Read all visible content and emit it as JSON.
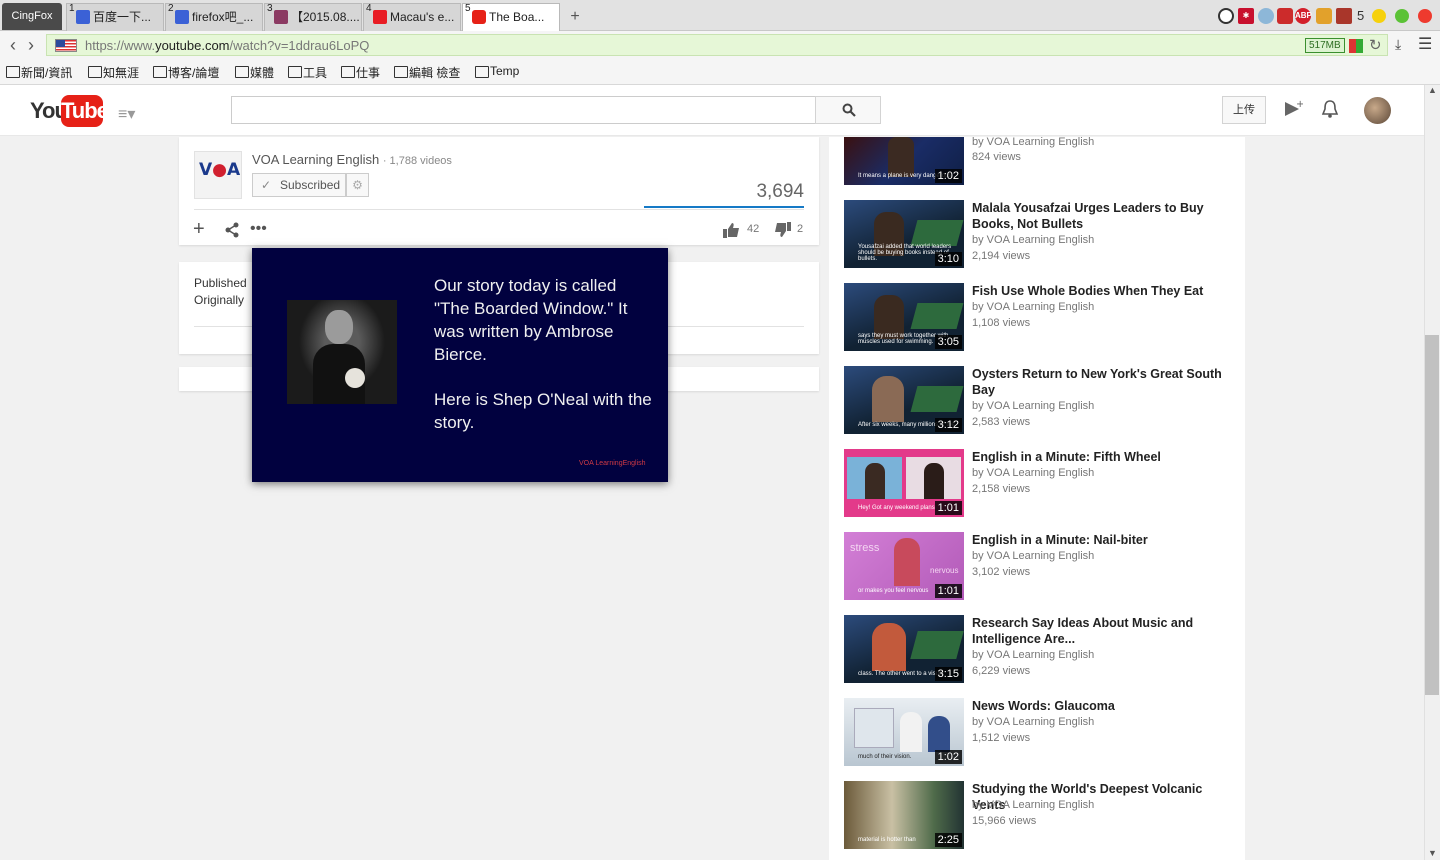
{
  "browser": {
    "app_name": "CingFox",
    "tabs": [
      {
        "num": "1",
        "label": "百度一下...",
        "color": "#3b61d6"
      },
      {
        "num": "2",
        "label": "firefox吧_...",
        "color": "#3b61d6"
      },
      {
        "num": "3",
        "label": "【2015.08....",
        "color": "#8b3a62"
      },
      {
        "num": "4",
        "label": "Macau's e...",
        "color": "#e81c24"
      },
      {
        "num": "5",
        "label": "The Boa...",
        "color": "#e62117"
      }
    ],
    "new_tab_label": "+",
    "url_prefix": "https://www.",
    "url_host": "youtube.com",
    "url_path": "/watch?v=1ddrau6LoPQ",
    "memory": "517MB",
    "ext_count": "5",
    "bookmarks": [
      "新聞/資訊",
      "知無涯",
      "博客/論壇",
      "媒體",
      "工具",
      "仕事",
      "編輯 檢查",
      "Temp"
    ]
  },
  "youtube": {
    "logo_you": "You",
    "logo_tube": "Tube",
    "upload_label": "上传",
    "search_placeholder": ""
  },
  "video": {
    "channel_name": "VOA Learning English",
    "channel_videos": "· 1,788 videos",
    "subscribe_label": "Subscribed",
    "view_count": "3,694",
    "likes": "42",
    "dislikes": "2",
    "published_line": "Published",
    "originally_line": "Originally",
    "card_text_1": "Our story today is called \"The Boarded Window.\" It was written by Ambrose Bierce.",
    "card_text_2": "Here is Shep O'Neal with the story.",
    "card_watermark": "VOA LearningEnglish"
  },
  "related": [
    {
      "title": "",
      "by": "by VOA Learning English",
      "views": "824 views",
      "duration": "1:02",
      "caption": "It means a plane is very dangerous"
    },
    {
      "title": "Malala Yousafzai Urges Leaders to Buy Books, Not Bullets",
      "by": "by VOA Learning English",
      "views": "2,194 views",
      "duration": "3:10",
      "caption": "Yousafzai added that world leaders should be buying books instead of bullets."
    },
    {
      "title": "Fish Use Whole Bodies When They Eat",
      "by": "by VOA Learning English",
      "views": "1,108 views",
      "duration": "3:05",
      "caption": "says they must work together with muscles used for swimming."
    },
    {
      "title": "Oysters Return to New York's Great South Bay",
      "by": "by VOA Learning English",
      "views": "2,583 views",
      "duration": "3:12",
      "caption": "After six weeks, many millions of the"
    },
    {
      "title": "English in a Minute: Fifth Wheel",
      "by": "by VOA Learning English",
      "views": "2,158 views",
      "duration": "1:01",
      "caption": "Hey! Got any weekend plans"
    },
    {
      "title": "English in a Minute: Nail-biter",
      "by": "by VOA Learning English",
      "views": "3,102 views",
      "duration": "1:01",
      "caption": "or makes you feel nervous"
    },
    {
      "title": "Research Say Ideas About Music and Intelligence Are...",
      "by": "by VOA Learning English",
      "views": "6,229 views",
      "duration": "3:15",
      "caption": "class. The other went to a visual"
    },
    {
      "title": "News Words: Glaucoma",
      "by": "by VOA Learning English",
      "views": "1,512 views",
      "duration": "1:02",
      "caption": "much of their vision."
    },
    {
      "title": "Studying the World's Deepest Volcanic Vents",
      "by": "by VOA Learning English",
      "views": "15,966 views",
      "duration": "2:25",
      "caption": "material is hotter than"
    }
  ]
}
